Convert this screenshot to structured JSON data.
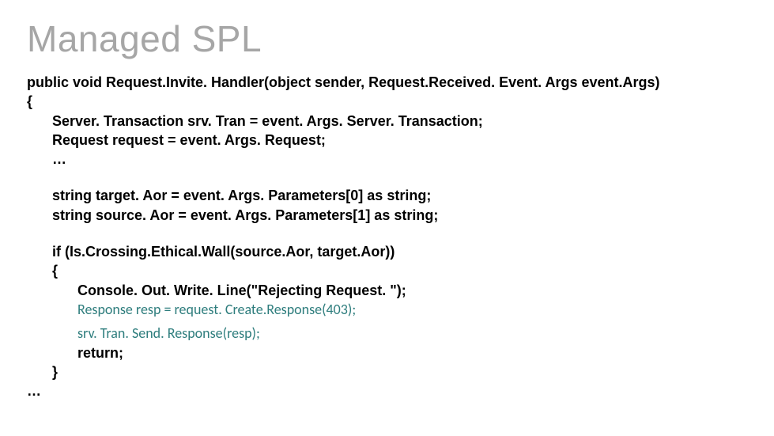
{
  "title": "Managed SPL",
  "code": {
    "line1": "public void Request.Invite. Handler(object sender, Request.Received. Event. Args event.Args)",
    "line2": "{",
    "line3": "Server. Transaction srv. Tran = event. Args. Server. Transaction;",
    "line4": "Request request = event. Args. Request;",
    "line5": "…",
    "line6": "string target. Aor = event. Args. Parameters[0] as string;",
    "line7": "string source. Aor = event. Args. Parameters[1] as string;",
    "line8": "if (Is.Crossing.Ethical.Wall(source.Aor, target.Aor))",
    "line9": "{",
    "line10": "Console. Out. Write. Line(\"Rejecting Request. \");",
    "line11": "Response resp = request. Create.Response(403);",
    "line12": "srv. Tran. Send. Response(resp);",
    "line13": "return;",
    "line14": "}",
    "line15": "…"
  }
}
